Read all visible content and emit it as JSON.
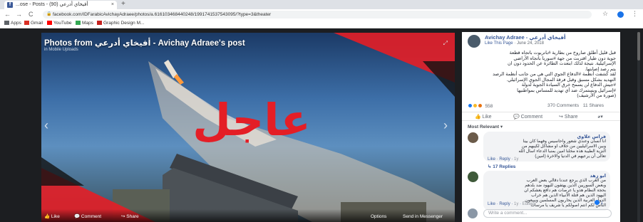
{
  "browser": {
    "tab_title": "...ose - Posts - أفيخاي أدرعي (90)",
    "tab_close": "×",
    "new_tab": "+",
    "back": "←",
    "forward": "→",
    "reload": "C",
    "url": "facebook.com/IDFarabicAvichayAdraee/photos/a.616103468440248/1991741537543095/?type=3&theater",
    "bookmarks": [
      {
        "label": "Apps",
        "icon": "apps-icon",
        "color": "#5f6368"
      },
      {
        "label": "Gmail",
        "icon": "gmail-icon",
        "color": "#d93025"
      },
      {
        "label": "YouTube",
        "icon": "youtube-icon",
        "color": "#ff0000"
      },
      {
        "label": "Maps",
        "icon": "maps-icon",
        "color": "#34a853"
      },
      {
        "label": "Graphic Design M...",
        "icon": "bookmark-icon",
        "color": "#c5221f"
      }
    ]
  },
  "photo": {
    "title": "Photos from أفيخاي أدرعي - Avichay Adraee's post",
    "subtitle": "in Mobile Uploads",
    "overlay_text": "عاجل",
    "footer_like": "Like",
    "footer_comment": "Comment",
    "footer_share": "Share",
    "footer_options": "Options",
    "footer_send": "Send in Messenger",
    "accent": "#e41e26"
  },
  "post": {
    "author": "Avichay Adraee - أفيخاي أدرعي",
    "like_page": "Like This Page",
    "date": "June 24, 2018",
    "lines": [
      "قبل قليل أطلق صاروخ من بطارية #باتريوت باتجاه قطعة",
      "جوية دون طيار اقتربت من جهة #سوريا باتجاه الأراضي",
      "الإسرائيلية. نتيجة لذلك ابتعدت الطائرة عن الحدود دون ان",
      "يتم رصد إصابتها.",
      "لقد كشفت أنظمة #الدفاع الجوي التي هي من جانب أنظمة الرصد",
      "التهديد بشكل مسبق وقبل فرقة المجال الجوي الإسرائيلي.",
      "#جيش الدفاع لن يسمح خرق السيادة الجوية لدولة",
      "#إسرائيل ويستمرك ضد أي تهديد للمساس بمواطنيها",
      "(صورة من الأرشيف)"
    ],
    "reactions_count": "558",
    "comments_count": "370 Comments",
    "shares_count": "11 Shares",
    "like_label": "Like",
    "comment_label": "Comment",
    "share_label": "Share",
    "most_relevant": "Most Relevant ▾"
  },
  "comments": [
    {
      "name": "فراس علاوي",
      "lines": [
        "انا انسان وعندي شعور واحاسيس وفهما كان بينا",
        "وبين الاسرائيليين من خلاف او مشاكل لكيبهم من",
        "النزية الطيبة هذه مخلنا امين بمنبا الدعاء اسال الله",
        "تعالى أن يرعيهم في الدنيا والاخرة (امين)"
      ],
      "like": "Like",
      "reply": "Reply",
      "time": "1y",
      "replies": "17 Replies"
    },
    {
      "name": "ابو زهد",
      "lines": [
        "من الغرب الذي يرجع عندنا دقالي بعض العرب",
        "وبعض السوريين الذين يهتفون لليهود ضد بلدهم",
        "بحجة النظام هذو يا عرصات هم دافع يعشكم ان",
        "اليهود الذين هم قتلة الأنبياء الذين هم خراب",
        "الدول العربية الذين يحاربون المسلمين ويبيعون",
        "الناس لكم انتم اصولكم يا شريف يا مرسات"
      ],
      "like": "Like",
      "reply": "Reply",
      "time": "1y",
      "edited": "Edited",
      "reacts": "1"
    }
  ],
  "write_placeholder": "Write a comment..."
}
